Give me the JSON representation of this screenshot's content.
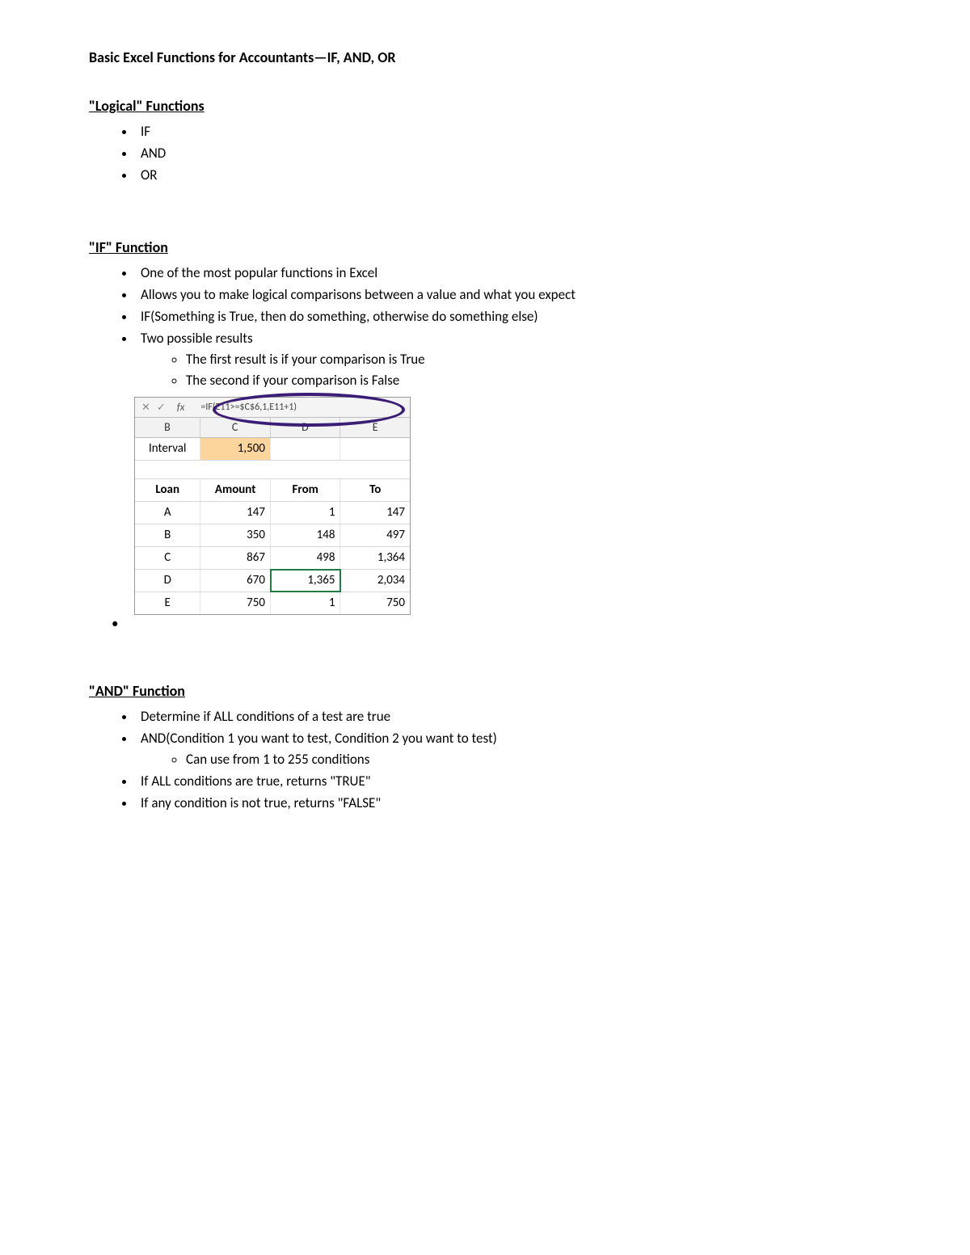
{
  "title": "Basic Excel Functions for Accountants—IF, AND, OR",
  "sections": {
    "logical": {
      "heading": "\"Logical\" Functions",
      "items": [
        "IF",
        "AND",
        "OR"
      ]
    },
    "if_fn": {
      "heading": "\"IF\" Function",
      "bullets": [
        "One of the most popular functions in Excel",
        "Allows you to make logical comparisons between a value and what you expect",
        "IF(Something is True, then do something, otherwise do something else)",
        "Two possible results"
      ],
      "sub_bullets": [
        "The first result is if your comparison is True",
        "The second if your comparison is False"
      ]
    },
    "and_fn": {
      "heading": "\"AND\" Function",
      "bullets": [
        "Determine if ALL conditions of a test are true",
        "AND(Condition 1 you   want to test, Condition 2 you want to test)",
        "If ALL conditions are true, returns \"TRUE\"",
        "If any condition is not true, returns \"FALSE\""
      ],
      "sub_bullets": [
        "Can use from 1 to 255  conditions"
      ]
    }
  },
  "excel": {
    "formula_bar": "=IF(E11>=$C$6,1,E11+1)",
    "fx_label": "fx",
    "col_headers": [
      "B",
      "C",
      "D",
      "E"
    ],
    "interval_label": "Interval",
    "interval_value": "1,500",
    "table_headers": [
      "Loan",
      "Amount",
      "From",
      "To"
    ],
    "rows": [
      {
        "loan": "A",
        "amount": "147",
        "from": "1",
        "to": "147"
      },
      {
        "loan": "B",
        "amount": "350",
        "from": "148",
        "to": "497"
      },
      {
        "loan": "C",
        "amount": "867",
        "from": "498",
        "to": "1,364"
      },
      {
        "loan": "D",
        "amount": "670",
        "from": "1,365",
        "to": "2,034"
      },
      {
        "loan": "E",
        "amount": "750",
        "from": "1",
        "to": "750"
      }
    ]
  }
}
